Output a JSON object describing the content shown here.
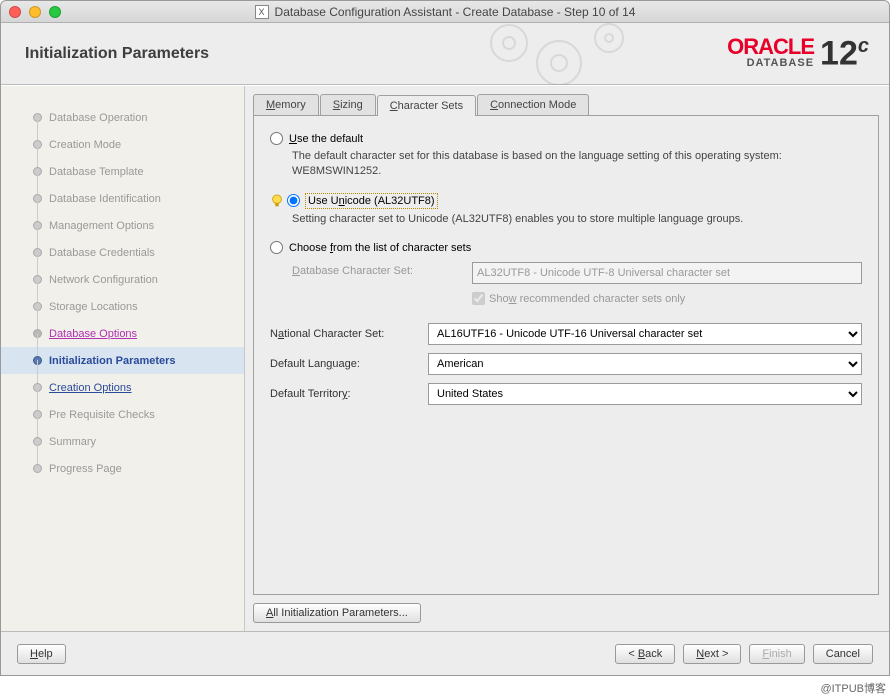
{
  "window_title": "Database Configuration Assistant - Create Database - Step 10 of 14",
  "page_title": "Initialization Parameters",
  "logo": {
    "brand": "ORACLE",
    "product": "DATABASE",
    "version": "12",
    "suffix": "c"
  },
  "steps": [
    {
      "label": "Database Operation",
      "state": "disabled"
    },
    {
      "label": "Creation Mode",
      "state": "disabled"
    },
    {
      "label": "Database Template",
      "state": "disabled"
    },
    {
      "label": "Database Identification",
      "state": "disabled"
    },
    {
      "label": "Management Options",
      "state": "disabled"
    },
    {
      "label": "Database Credentials",
      "state": "disabled"
    },
    {
      "label": "Network Configuration",
      "state": "disabled"
    },
    {
      "label": "Storage Locations",
      "state": "disabled"
    },
    {
      "label": "Database Options",
      "state": "visited"
    },
    {
      "label": "Initialization Parameters",
      "state": "active"
    },
    {
      "label": "Creation Options",
      "state": "next"
    },
    {
      "label": "Pre Requisite Checks",
      "state": "disabled"
    },
    {
      "label": "Summary",
      "state": "disabled"
    },
    {
      "label": "Progress Page",
      "state": "disabled"
    }
  ],
  "tabs": [
    {
      "label": "Memory",
      "active": false
    },
    {
      "label": "Sizing",
      "active": false
    },
    {
      "label": "Character Sets",
      "active": true
    },
    {
      "label": "Connection Mode",
      "active": false
    }
  ],
  "charset": {
    "use_default_label": "Use the default",
    "use_default_desc": "The default character set for this database is based on the language setting of this operating system: WE8MSWIN1252.",
    "use_unicode_label": "Use Unicode (AL32UTF8)",
    "use_unicode_desc": "Setting character set to Unicode (AL32UTF8) enables you to store multiple language groups.",
    "choose_list_label": "Choose from the list of character sets",
    "db_charset_label": "Database Character Set:",
    "db_charset_value": "AL32UTF8 - Unicode UTF-8 Universal character set",
    "show_recommended": "Show recommended character sets only",
    "national_label": "National Character Set:",
    "national_value": "AL16UTF16 - Unicode UTF-16 Universal character set",
    "lang_label": "Default Language:",
    "lang_value": "American",
    "territory_label": "Default Territory:",
    "territory_value": "United States"
  },
  "buttons": {
    "all_params": "All Initialization Parameters...",
    "help": "Help",
    "back": "< Back",
    "next": "Next >",
    "finish": "Finish",
    "cancel": "Cancel"
  },
  "watermark": "@ITPUB博客"
}
